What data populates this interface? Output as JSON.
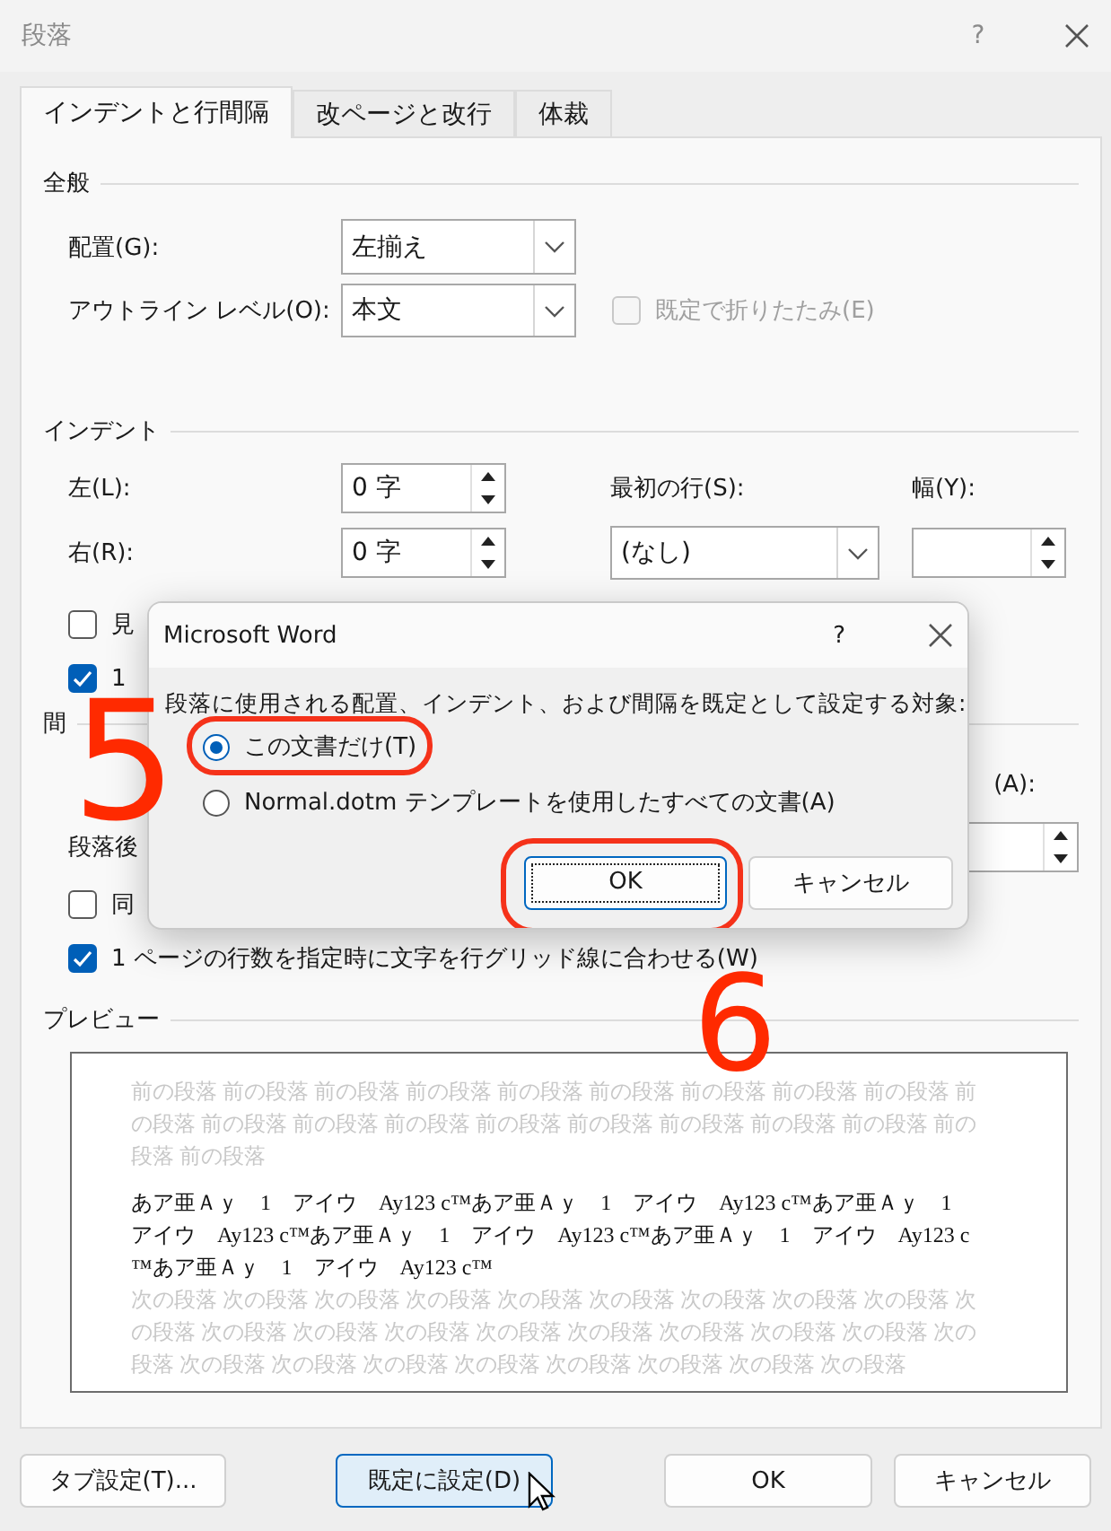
{
  "window": {
    "title": "段落",
    "help": "?"
  },
  "tabs": [
    {
      "label": "インデントと行間隔",
      "selected": true
    },
    {
      "label": "改ページと改行",
      "selected": false
    },
    {
      "label": "体裁",
      "selected": false
    }
  ],
  "general": {
    "heading": "全般",
    "fields": [
      {
        "label": "配置(G):",
        "value": "左揃え"
      },
      {
        "label": "アウトライン レベル(O):",
        "value": "本文"
      }
    ],
    "collapse_checkbox": {
      "label": "既定で折りたたみ(E)",
      "checked": false,
      "disabled": true
    }
  },
  "indent": {
    "heading": "インデント",
    "left": {
      "label": "左(L):",
      "value": "0 字"
    },
    "right": {
      "label": "右(R):",
      "value": "0 字"
    },
    "first_line": {
      "label": "最初の行(S):",
      "value": "(なし)"
    },
    "width": {
      "label": "幅(Y):"
    },
    "checkboxes": [
      {
        "label": "見",
        "checked": false
      },
      {
        "label": "1",
        "checked": true
      }
    ]
  },
  "spacing": {
    "heading": "間",
    "column_3_label": "(A):",
    "after_label": "段落後",
    "checkboxes": [
      {
        "label": "同",
        "checked": false
      },
      {
        "label": "1 ページの行数を指定時に文字を行グリッド線に合わせる(W)",
        "checked": true
      }
    ]
  },
  "preview": {
    "heading": "プレビュー",
    "previous": "前の段落 前の段落 前の段落 前の段落 前の段落 前の段落 前の段落 前の段落 前の段落 前の段落 前の段落 前の段落 前の段落 前の段落 前の段落 前の段落 前の段落 前の段落 前の段落 前の段落",
    "sample": "あア亜Ａｙ　1　アイウ　Ay123 c™あア亜Ａｙ　1　アイウ　Ay123 c™あア亜Ａｙ　1　アイウ　Ay123 c™あア亜Ａｙ　1　アイウ　Ay123 c™あア亜Ａｙ　1　アイウ　Ay123 c™あア亜Ａｙ　1　アイウ　Ay123 c™",
    "next": "次の段落 次の段落 次の段落 次の段落 次の段落 次の段落 次の段落 次の段落 次の段落 次の段落 次の段落 次の段落 次の段落 次の段落 次の段落 次の段落 次の段落 次の段落 次の段落 次の段落 次の段落 次の段落 次の段落 次の段落 次の段落 次の段落 次の段落"
  },
  "buttons": [
    {
      "label": "タブ設定(T)...",
      "hovered": false
    },
    {
      "label": "既定に設定(D)",
      "hovered": true
    },
    {
      "label": "OK",
      "hovered": false
    },
    {
      "label": "キャンセル",
      "hovered": false
    }
  ],
  "popup": {
    "title": "Microsoft Word",
    "help": "?",
    "message": "段落に使用される配置、インデント、および間隔を既定として設定する対象:",
    "options": [
      {
        "label": "この文書だけ(T)",
        "selected": true,
        "circled": true
      },
      {
        "label": "Normal.dotm テンプレートを使用したすべての文書(A)",
        "selected": false,
        "circled": false
      }
    ],
    "buttons": [
      {
        "label": "OK",
        "focused": true,
        "circled": true
      },
      {
        "label": "キャンセル",
        "focused": false,
        "circled": false
      }
    ]
  },
  "annotations": [
    {
      "label": "5"
    },
    {
      "label": "6"
    }
  ]
}
